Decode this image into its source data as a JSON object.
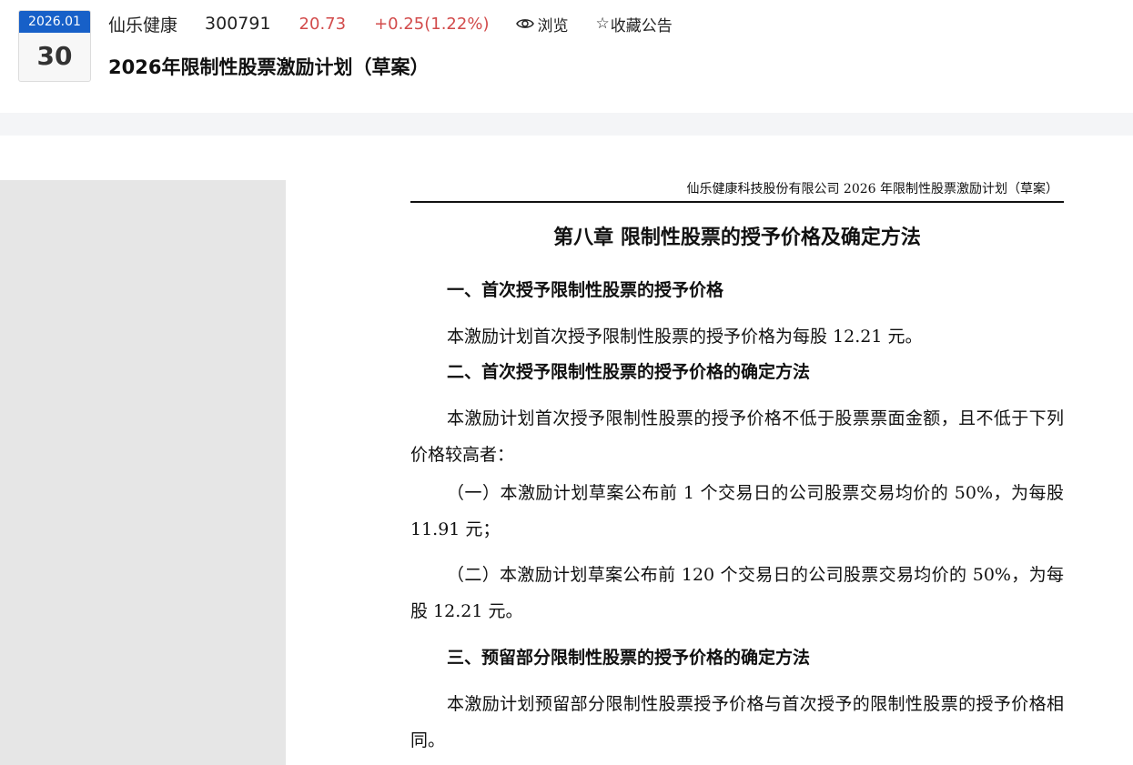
{
  "date": {
    "year_month": "2026.01",
    "day": "30"
  },
  "stock": {
    "name": "仙乐健康",
    "code": "300791",
    "price": "20.73",
    "change": "+0.25(1.22%)",
    "browse_label": "浏览",
    "favorite_label": "收藏公告"
  },
  "doc_title": "2026年限制性股票激励计划（草案）",
  "document": {
    "running_header": "仙乐健康科技股份有限公司 2026 年限制性股票激励计划（草案）",
    "chapter": "第八章  限制性股票的授予价格及确定方法",
    "sec1": "一、首次授予限制性股票的授予价格",
    "p1": "本激励计划首次授予限制性股票的授予价格为每股 12.21 元。",
    "sec2": "二、首次授予限制性股票的授予价格的确定方法",
    "p2": "本激励计划首次授予限制性股票的授予价格不低于股票票面金额，且不低于下列价格较高者：",
    "p3": "（一）本激励计划草案公布前 1 个交易日的公司股票交易均价的 50%，为每股 11.91 元；",
    "p4": "（二）本激励计划草案公布前 120 个交易日的公司股票交易均价的 50%，为每股 12.21 元。",
    "sec3": "三、预留部分限制性股票的授予价格的确定方法",
    "p5": "本激励计划预留部分限制性股票授予价格与首次授予的限制性股票的授予价格相同。"
  },
  "colors": {
    "accent_blue": "#1760c8",
    "price_red": "#d24b4b"
  },
  "icons": {
    "browse": "eye-icon",
    "favorite": "star-icon"
  }
}
